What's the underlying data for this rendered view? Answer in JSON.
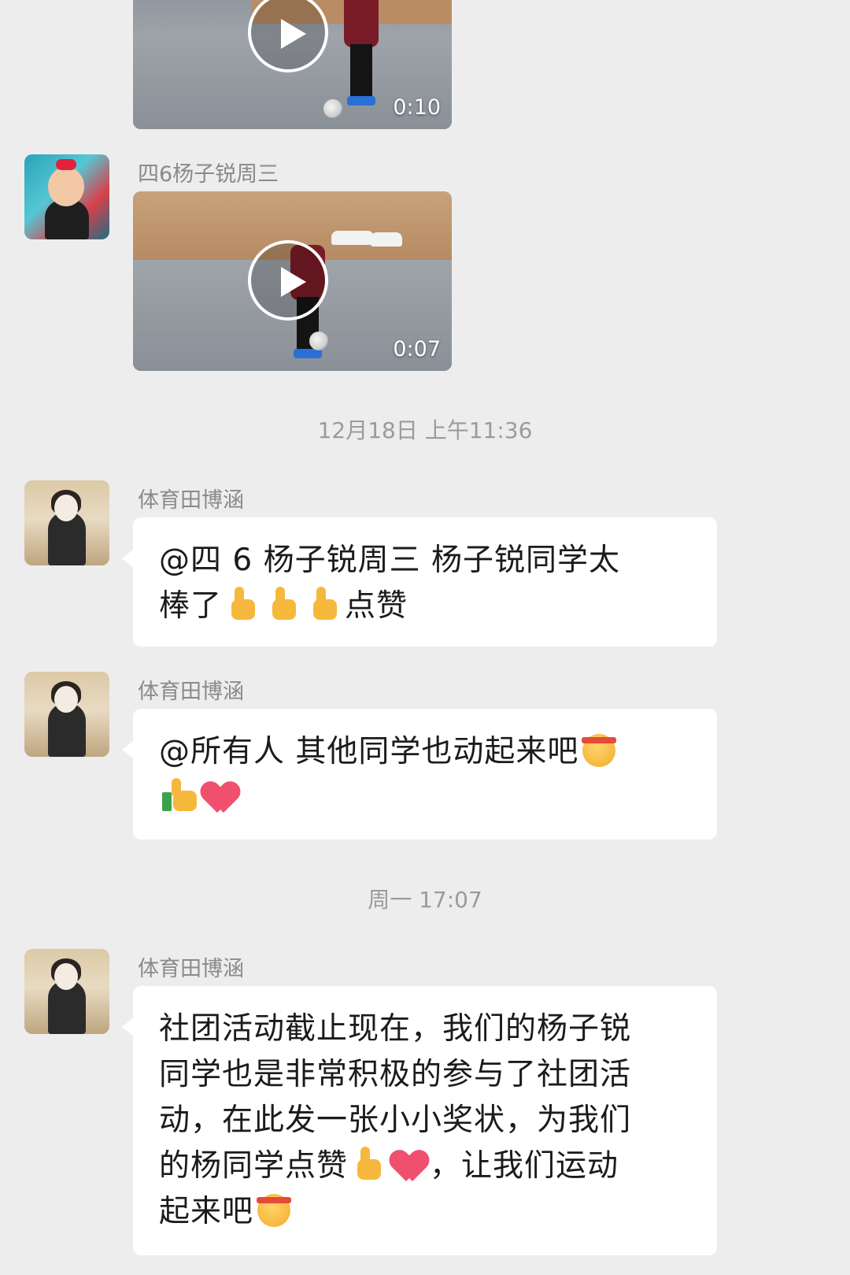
{
  "messages": [
    {
      "type": "video",
      "duration": "0:10",
      "avatar": "kid-avatar",
      "sender": ""
    },
    {
      "type": "video",
      "sender": "四6杨子锐周三",
      "duration": "0:07",
      "avatar": "kid-avatar"
    }
  ],
  "timestamps": [
    "12月18日 上午11:36",
    "周一 17:07"
  ],
  "texts": [
    {
      "sender": "体育田博涵",
      "lines": [
        "@四 6 杨子锐周三  杨子锐同学太",
        "棒了",
        "点赞"
      ],
      "emojis": [
        "thumbs-up-emoji",
        "thumbs-up-emoji",
        "thumbs-up-emoji"
      ]
    },
    {
      "sender": "体育田博涵",
      "lines": [
        "@所有人  其他同学也动起来吧"
      ],
      "emojis": [
        "determined-face-emoji",
        "thumbs-up-emoji",
        "heart-emoji"
      ]
    },
    {
      "sender": "体育田博涵",
      "lines": [
        "社团活动截止现在，我们的杨子锐",
        "同学也是非常积极的参与了社团活",
        "动，在此发一张小小奖状，为我们",
        "的杨同学点赞",
        "，让我们运动",
        "起来吧"
      ],
      "emojis": [
        "thumbs-up-emoji",
        "heart-emoji",
        "determined-face-emoji"
      ]
    }
  ],
  "colors": {
    "background": "#ededed",
    "bubble": "#ffffff",
    "sender_text": "#8a8a8a",
    "timestamp_text": "#9b9b9b"
  }
}
